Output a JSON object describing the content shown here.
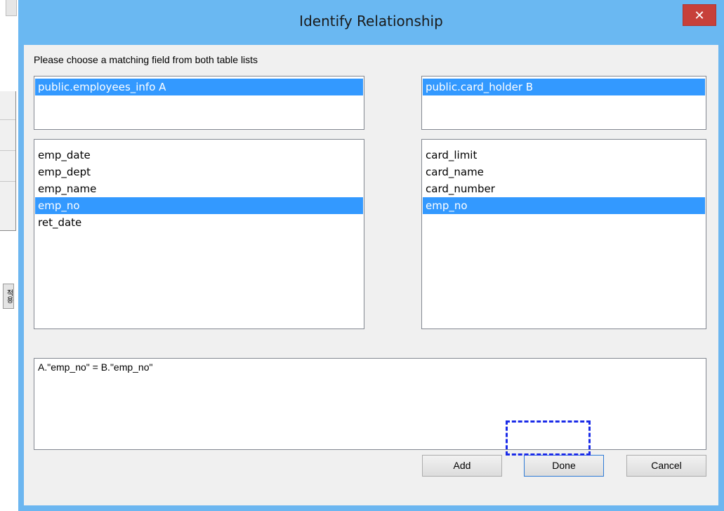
{
  "background_window": {
    "button_label": "적용"
  },
  "dialog": {
    "title": "Identify Relationship",
    "close_label": "✕",
    "instruction": "Please choose a matching field from both table lists",
    "left_table_list": {
      "items": [
        "public.employees_info A"
      ],
      "selected_index": 0
    },
    "right_table_list": {
      "items": [
        "public.card_holder B"
      ],
      "selected_index": 0
    },
    "left_field_list": {
      "items": [
        "emp_date",
        "emp_dept",
        "emp_name",
        "emp_no",
        "ret_date"
      ],
      "selected_index": 3
    },
    "right_field_list": {
      "items": [
        "card_limit",
        "card_name",
        "card_number",
        "emp_no"
      ],
      "selected_index": 3
    },
    "expression": "A.\"emp_no\" = B.\"emp_no\"",
    "buttons": {
      "add_label": "Add",
      "done_label": "Done",
      "cancel_label": "Cancel"
    }
  },
  "colors": {
    "title_bar": "#6ab8f2",
    "close_button": "#c7403a",
    "selection": "#3399ff",
    "focus_highlight": "#1a2be8"
  }
}
